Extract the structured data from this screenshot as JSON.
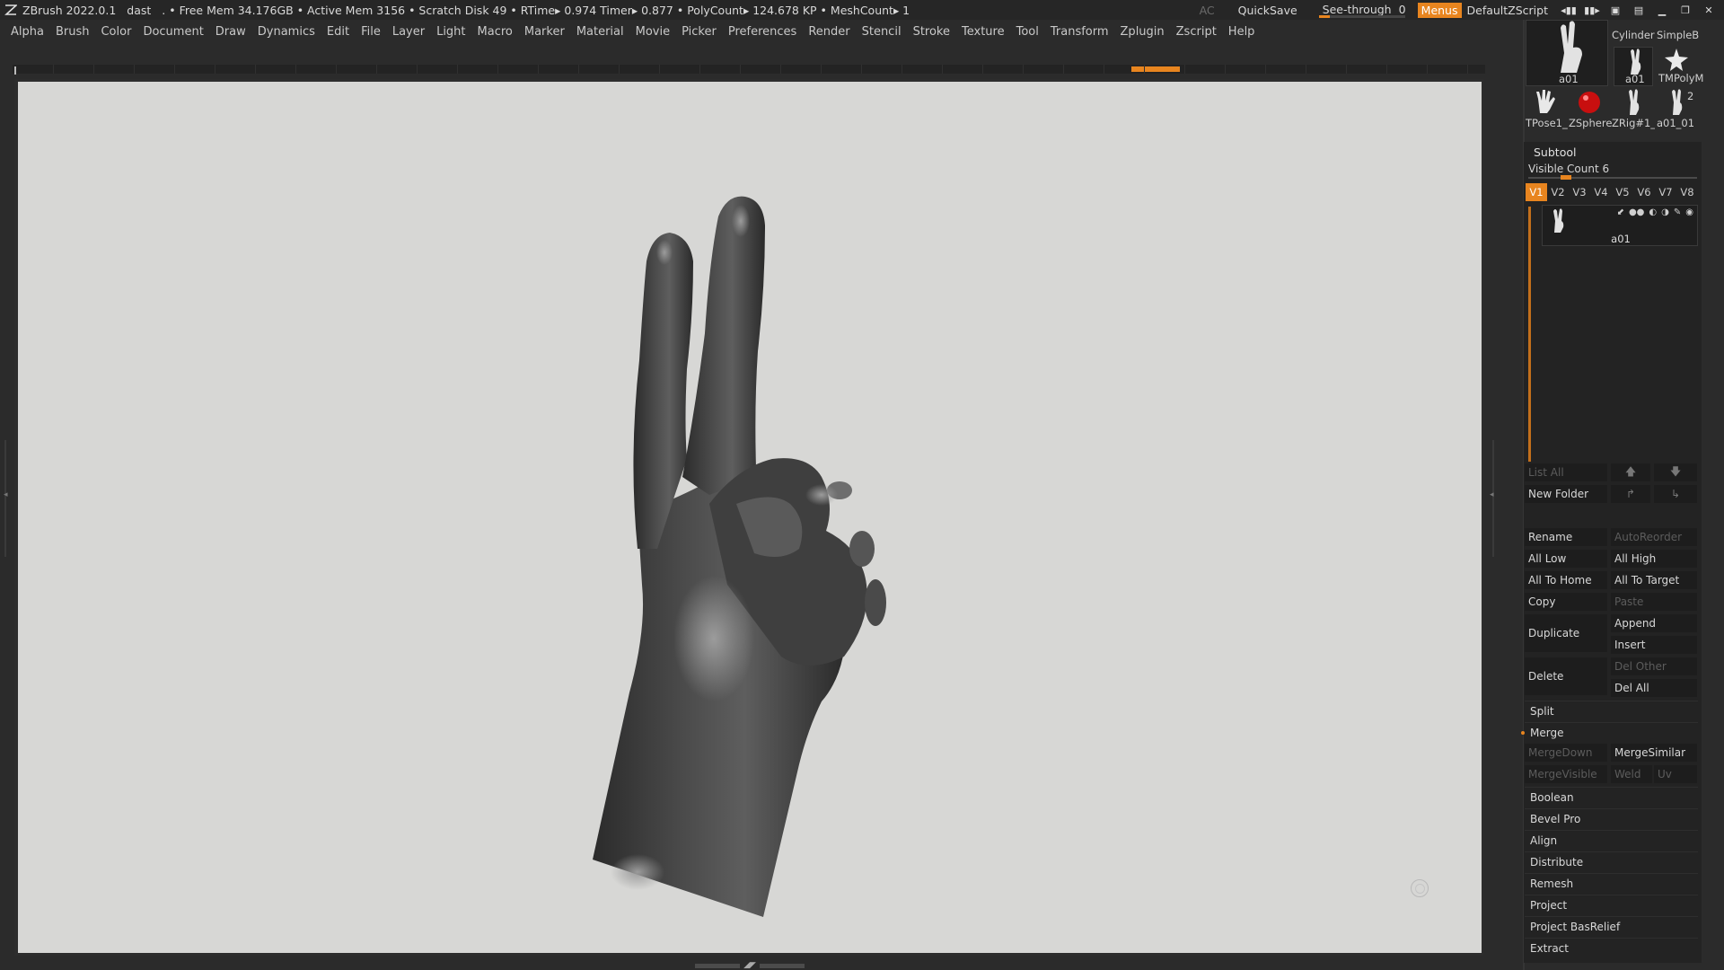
{
  "titlebar": {
    "app": "ZBrush 2022.0.1",
    "user": "dast",
    "stats": ". • Free Mem 34.176GB • Active Mem 3156 • Scratch Disk 49 •  RTime▸ 0.974 Timer▸ 0.877 • PolyCount▸ 124.678 KP  • MeshCount▸ 1",
    "ac": "AC",
    "quicksave": "QuickSave",
    "see_through_label": "See-through",
    "see_through_value": "0",
    "see_through_level": 0,
    "menus": "Menus",
    "default_zscript": "DefaultZScript"
  },
  "menubar": [
    "Alpha",
    "Brush",
    "Color",
    "Document",
    "Draw",
    "Dynamics",
    "Edit",
    "File",
    "Layer",
    "Light",
    "Macro",
    "Marker",
    "Material",
    "Movie",
    "Picker",
    "Preferences",
    "Render",
    "Stencil",
    "Stroke",
    "Texture",
    "Tool",
    "Transform",
    "Zplugin",
    "Zscript",
    "Help"
  ],
  "tools": {
    "main": "a01",
    "cylinder": "Cylinder",
    "simpleb": "SimpleB",
    "a01_small": "a01",
    "tmpoly": "TMPolyM",
    "tpose": "TPose1_",
    "zsphere": "ZSphere",
    "zrig": "ZRig#1_",
    "a01_01": "a01_01",
    "a01_01_badge": "2"
  },
  "subtool": {
    "title": "Subtool",
    "visible_count_label": "Visible Count",
    "visible_count": "6",
    "versions": [
      "V1",
      "V2",
      "V3",
      "V4",
      "V5",
      "V6",
      "V7",
      "V8"
    ],
    "active_version": "V1",
    "items": [
      {
        "name": "a01"
      }
    ],
    "list_all": "List All",
    "new_folder": "New Folder",
    "rename": "Rename",
    "auto_reorder": "AutoReorder",
    "all_low": "All Low",
    "all_high": "All High",
    "all_to_home": "All To Home",
    "all_to_target": "All To Target",
    "copy": "Copy",
    "paste": "Paste",
    "duplicate": "Duplicate",
    "append": "Append",
    "insert": "Insert",
    "delete": "Delete",
    "del_other": "Del Other",
    "del_all": "Del All"
  },
  "sections": {
    "split": "Split",
    "merge": "Merge",
    "merge_down": "MergeDown",
    "merge_similar": "MergeSimilar",
    "merge_visible": "MergeVisible",
    "weld": "Weld",
    "uv": "Uv",
    "boolean": "Boolean",
    "bevel_pro": "Bevel Pro",
    "align": "Align",
    "distribute": "Distribute",
    "remesh": "Remesh",
    "project": "Project",
    "project_basrelief": "Project BasRelief",
    "extract": "Extract"
  }
}
